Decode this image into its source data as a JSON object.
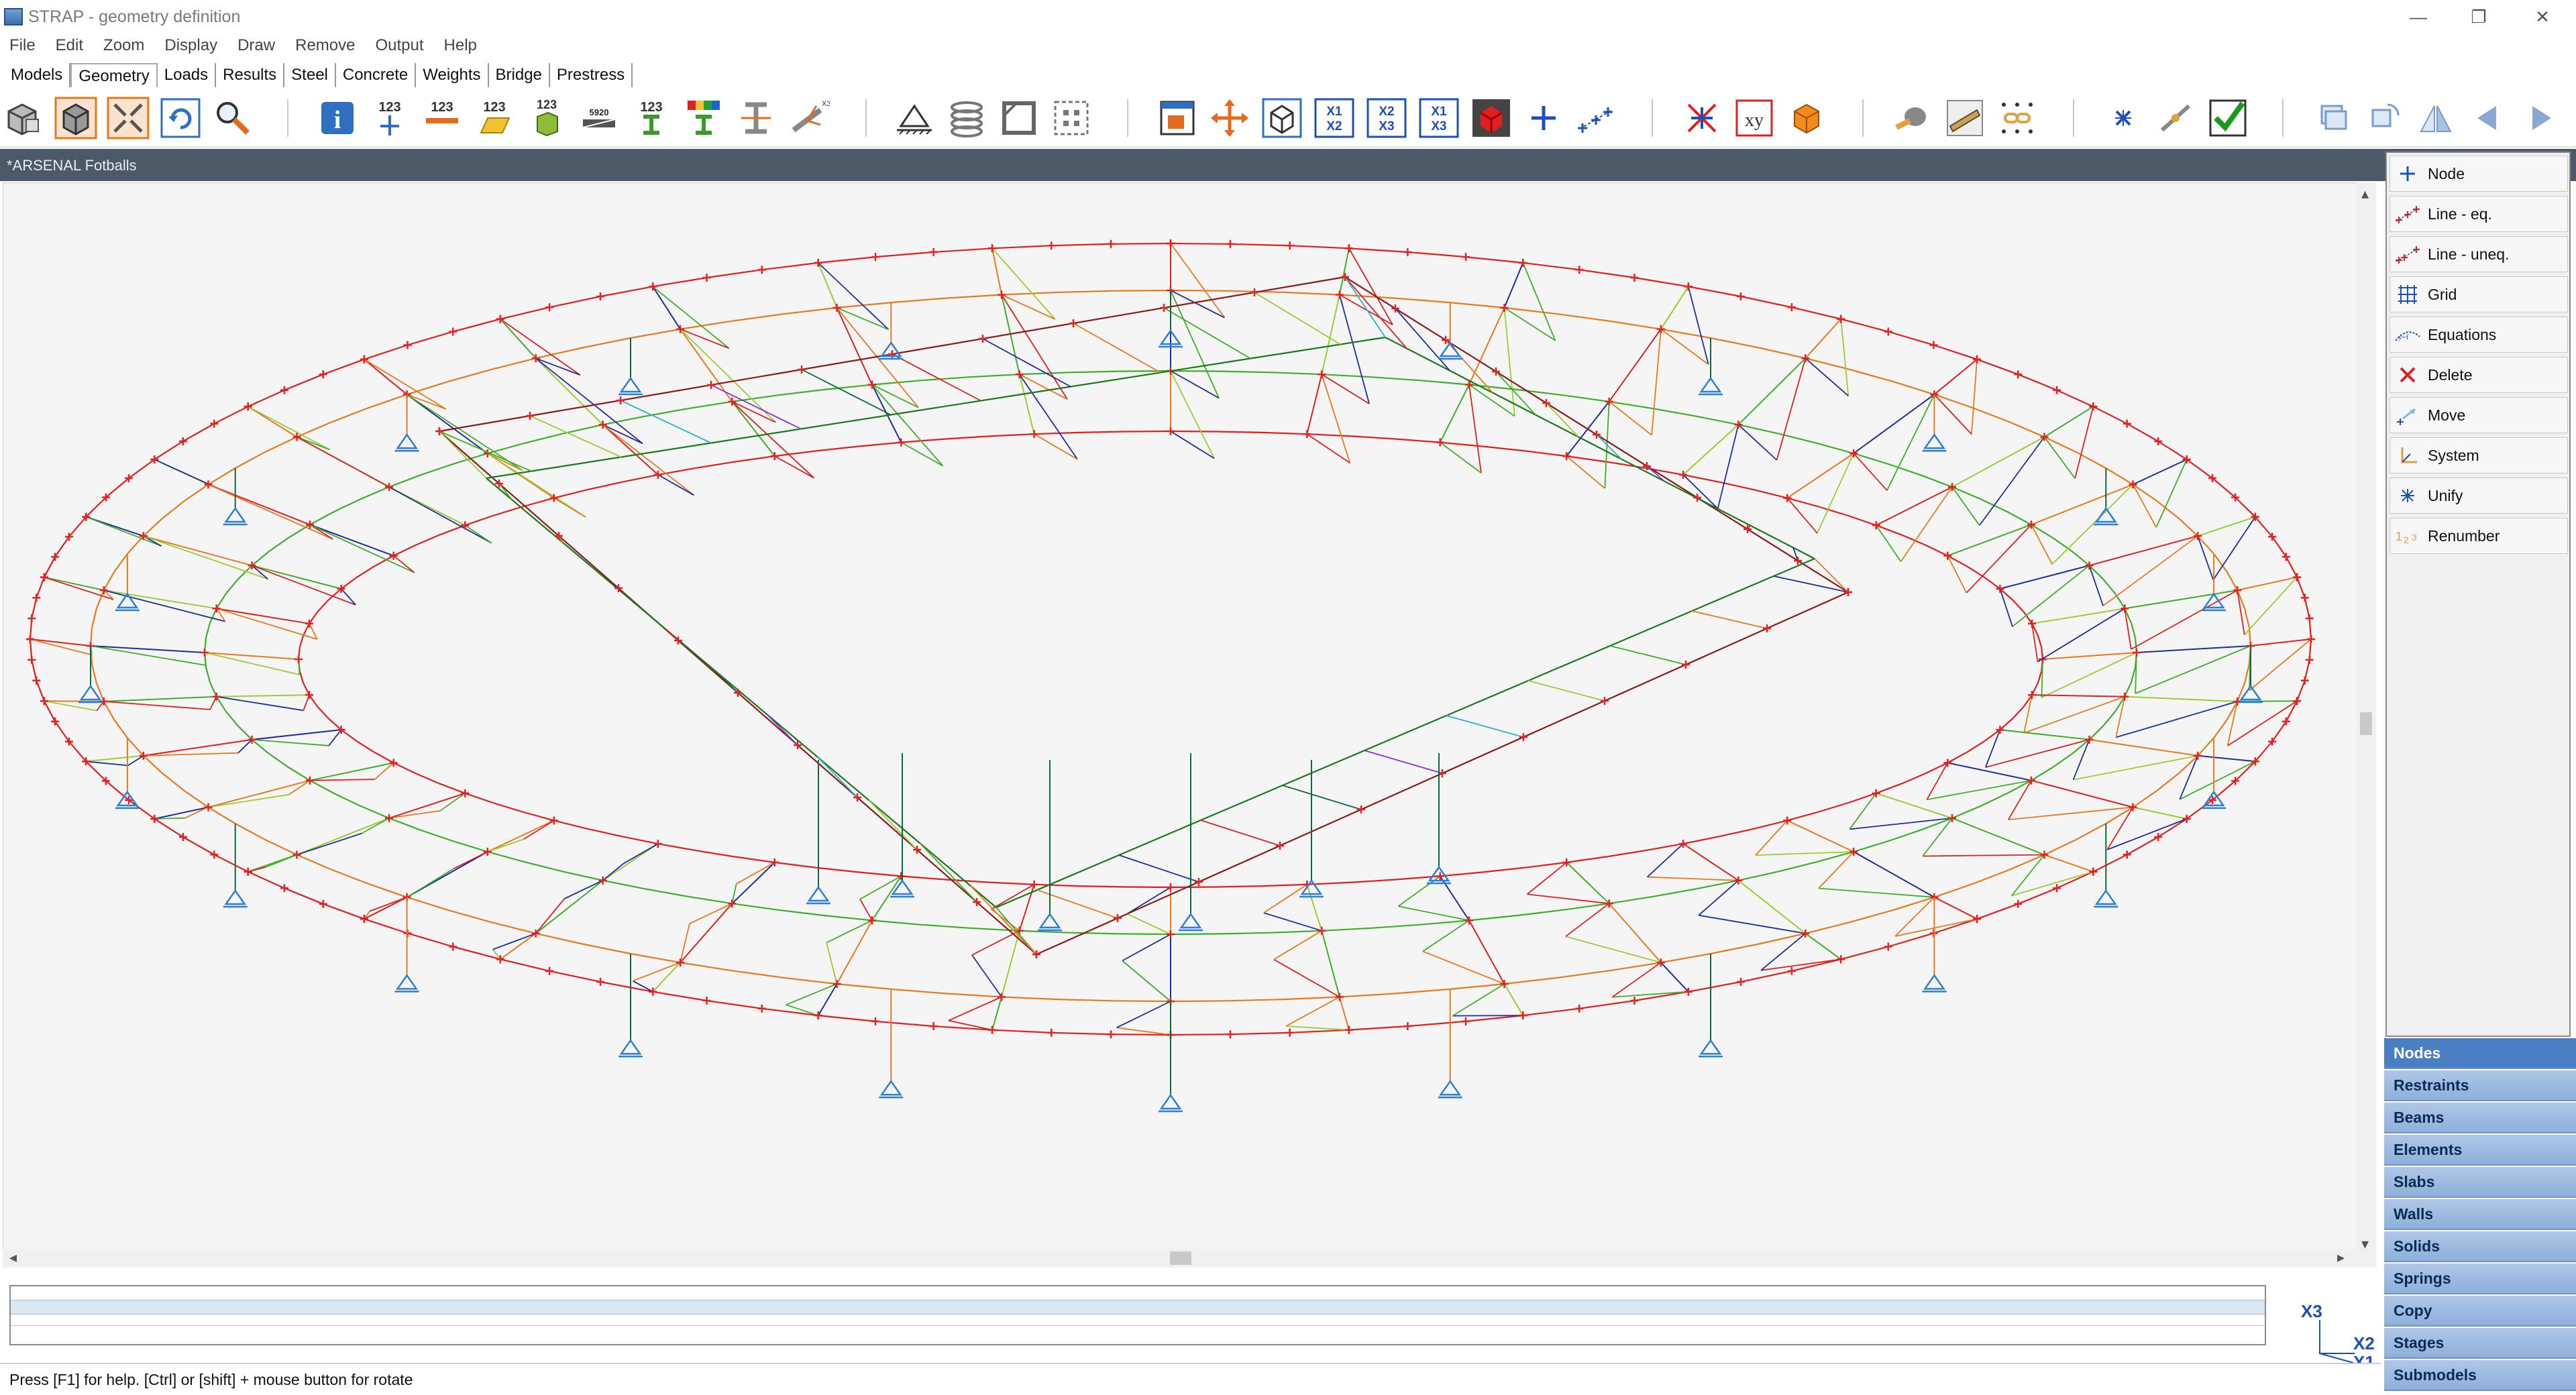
{
  "window": {
    "title": "STRAP - geometry definition",
    "controls": [
      "—",
      "❐",
      "✕"
    ]
  },
  "menu": [
    "File",
    "Edit",
    "Zoom",
    "Display",
    "Draw",
    "Remove",
    "Output",
    "Help"
  ],
  "tabs": [
    "Models",
    "Geometry",
    "Loads",
    "Results",
    "Steel",
    "Concrete",
    "Weights",
    "Bridge",
    "Prestress"
  ],
  "active_tab": "Geometry",
  "toolbar": {
    "num_label": "123",
    "small_label": "5920",
    "axes_labels": {
      "x1x2_top": "X1",
      "x1x2_bot": "X2",
      "x2x3_top": "X2",
      "x2x3_bot": "X3",
      "x1x3_top": "X1",
      "x1x3_bot": "X3",
      "xy": "xy"
    }
  },
  "model_name": "*ARSENAL Fotballs",
  "commands": [
    "Node",
    "Line - eq.",
    "Line - uneq.",
    "Grid",
    "Equations",
    "Delete",
    "Move",
    "System",
    "Unify",
    "Renumber"
  ],
  "categories": [
    "Nodes",
    "Restraints",
    "Beams",
    "Elements",
    "Slabs",
    "Walls",
    "Solids",
    "Springs",
    "Copy",
    "Stages",
    "Submodels"
  ],
  "active_category": "Nodes",
  "axis_indicator": {
    "x3": "X3",
    "x2": "X2",
    "x1": "X1"
  },
  "status_text": "Press [F1] for help. [Ctrl] or [shift] + mouse button for rotate",
  "colors": {
    "accent": "#4a7fc3",
    "header_strip": "#4c5966",
    "restraint": "#2b7fd6",
    "node": "#e82020"
  }
}
